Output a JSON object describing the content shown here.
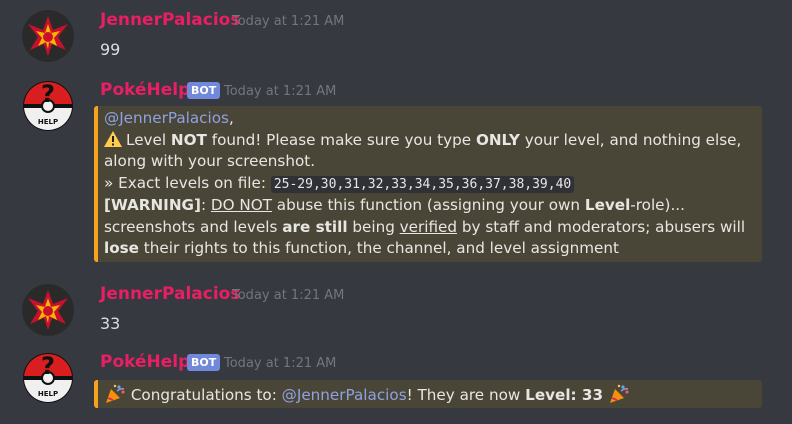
{
  "colors": {
    "bg": "#36393f",
    "user_name": "#e91e63",
    "embed_border": "#f8a41a",
    "embed_bg": "#4a4637",
    "mention": "#8ea1e1",
    "bot_tag": "#7289da"
  },
  "messages": [
    {
      "author": "JennerPalacios",
      "timestamp": "Today at 1:21 AM",
      "text": "99"
    },
    {
      "author": "PokéHelp",
      "bot_tag": "BOT",
      "timestamp": "Today at 1:21 AM",
      "embed": {
        "mention": "@JennerPalacios",
        "mention_suffix": ",",
        "l1_a": "Level ",
        "l1_b": "NOT",
        "l1_c": " found! Please make sure you type ",
        "l1_d": "ONLY",
        "l1_e": " your level, and nothing else,",
        "l2": "along with your screenshot.",
        "l3_a": " » Exact levels on file: ",
        "l3_code": "25-29,30,31,32,33,34,35,36,37,38,39,40",
        "l4_a": "[WARNING]",
        "l4_b": ": ",
        "l4_c": "DO NOT",
        "l4_d": " abuse this function (assigning your own ",
        "l4_e": "Level",
        "l4_f": "-role)...",
        "l5_a": "screenshots and levels ",
        "l5_b": "are still",
        "l5_c": " being ",
        "l5_d": "verified",
        "l5_e": " by staff and moderators; abusers will",
        "l6_a": "lose",
        "l6_b": " their rights to this function, the channel, and level assignment"
      }
    },
    {
      "author": "JennerPalacios",
      "timestamp": "Today at 1:21 AM",
      "text": "33"
    },
    {
      "author": "PokéHelp",
      "bot_tag": "BOT",
      "timestamp": "Today at 1:21 AM",
      "embed": {
        "a": " Congratulations to: ",
        "mention": "@JennerPalacios",
        "b": "! They are now ",
        "c": "Level: 33",
        "d": " "
      }
    }
  ]
}
